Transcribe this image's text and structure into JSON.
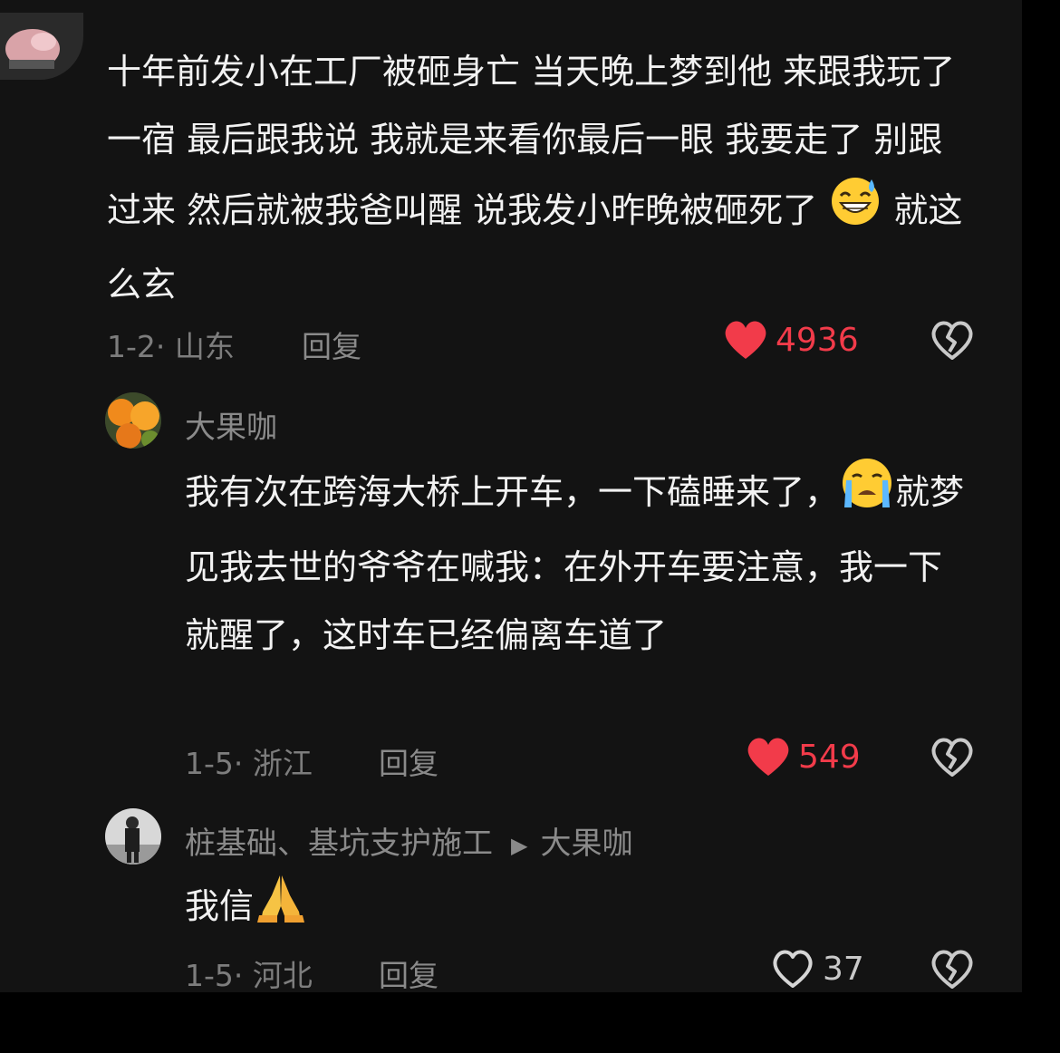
{
  "comments": [
    {
      "text_a": "十年前发小在工厂被砸身亡 当天晚上梦到他 来跟我玩了一宿 最后跟我说 我就是来看你最后一眼 我要走了 别跟过来 然后就被我爸叫醒 说我发小昨晚被砸死了",
      "emoji": "sweat-grin-emoji",
      "text_b": " 就这么玄",
      "date_loc": "1-2· 山东",
      "reply_label": "回复",
      "like_count": "4936",
      "liked": true
    },
    {
      "username": "大果咖",
      "text_a": "我有次在跨海大桥上开车，一下磕睡来了，",
      "emoji": "crying-face-emoji",
      "text_b": "就梦见我去世的爷爷在喊我：在外开车要注意，我一下就醒了，这时车已经偏离车道了",
      "date_loc": "1-5· 浙江",
      "reply_label": "回复",
      "like_count": "549",
      "liked": true
    },
    {
      "username": "桩基础、基坑支护施工",
      "reply_to": "大果咖",
      "text_a": "我信",
      "emoji": "folded-hands-emoji",
      "date_loc": "1-5· 河北",
      "reply_label": "回复",
      "like_count": "37",
      "liked": false
    }
  ],
  "colors": {
    "background": "#131313",
    "like_red": "#f23b4a",
    "muted": "#8a8a8a"
  },
  "icons": [
    "heart-icon",
    "broken-heart-icon",
    "play-arrow-icon"
  ]
}
